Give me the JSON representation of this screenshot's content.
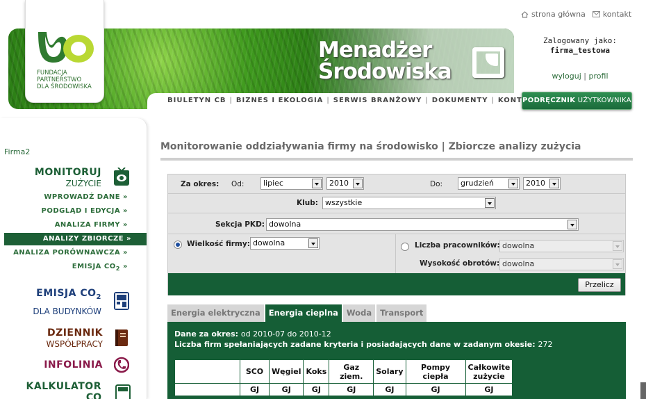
{
  "header": {
    "logo_lines": [
      "FUNDACJA",
      "PARTNERSTWO",
      "DLA ŚRODOWISKA"
    ],
    "brand_line1": "Menadżer",
    "brand_line2": "Środowiska",
    "topnav": [
      "BIULETYN CB",
      "BIZNES I EKOLOGIA",
      "SERWIS BRANŻOWY",
      "DOKUMENTY",
      "KONTAKT"
    ],
    "toplinks": {
      "home": "strona główna",
      "contact": "kontakt"
    },
    "user": {
      "logged_as": "Zalogowany jako:",
      "username": "firma_testowa",
      "logout": "wyloguj",
      "separator": "|",
      "profile": "profil"
    },
    "manual_bold": "PODRĘCZNIK",
    "manual_rest": " UŻYTKOWNIKA"
  },
  "sidebar": {
    "company": "Firma2",
    "monitoruj": {
      "t1": "MONITORUJ",
      "t2": "ZUŻYCIE"
    },
    "menu": [
      "WPROWADŹ DANE »",
      "PODGLĄD I EDYCJA »",
      "ANALIZA FIRMY »",
      "ANALIZY ZBIORCZE »",
      "ANALIZA PORÓWNAWCZA »",
      "EMISJA CO",
      "2",
      " »"
    ],
    "emisja": {
      "t1": "EMISJA CO",
      "sub": "2",
      "t2": "DLA BUDYNKÓW"
    },
    "dziennik": {
      "t1": "DZIENNIK",
      "t2": "WSPÓŁPRACY"
    },
    "infolinia": {
      "t1": "INFOLINIA"
    },
    "kalkulator": {
      "t1": "KALKULATOR",
      "t2": "CO"
    }
  },
  "main": {
    "title": "Monitorowanie oddziaływania firmy na środowisko | Zbiorcze analizy zużycia",
    "form": {
      "period_label": "Za okres:",
      "from_label": "Od:",
      "from_month": "lipiec",
      "from_year": "2010",
      "to_label": "Do:",
      "to_month": "grudzień",
      "to_year": "2010",
      "club_label": "Klub:",
      "club_value": "wszystkie",
      "pkd_label": "Sekcja PKD:",
      "pkd_value": "dowolna",
      "size_label": "Wielkość firmy:",
      "size_value": "dowolna",
      "employees_label": "Liczba pracowników:",
      "employees_value": "dowolna",
      "turnover_label": "Wysokość obrotów:",
      "turnover_value": "dowolna",
      "calc_button": "Przelicz"
    },
    "tabs": [
      "Energia elektryczna",
      "Energia cieplna",
      "Woda",
      "Transport"
    ],
    "active_tab": 1,
    "panel": {
      "period_label": "Dane za okres:",
      "period_value": "od 2010-07 do 2010-12",
      "count_label": "Liczba firm spełaniających zadane kryteria i posiadających dane w zadanym okesie:",
      "count_value": "272"
    },
    "table": {
      "headers": [
        "SCO",
        "Węgiel",
        "Koks",
        "Gaz ziem.",
        "Solary",
        "Pompy ciepła",
        "Całkowite zużycie"
      ],
      "units": [
        "GJ",
        "GJ",
        "GJ",
        "GJ",
        "GJ",
        "GJ",
        "GJ"
      ]
    }
  },
  "colors": {
    "brand_green": "#155e36",
    "link_green": "#2d6d3b",
    "dziennik": "#6b2a10",
    "infolinia": "#8a1a4a",
    "emisja": "#1e3f7a"
  }
}
